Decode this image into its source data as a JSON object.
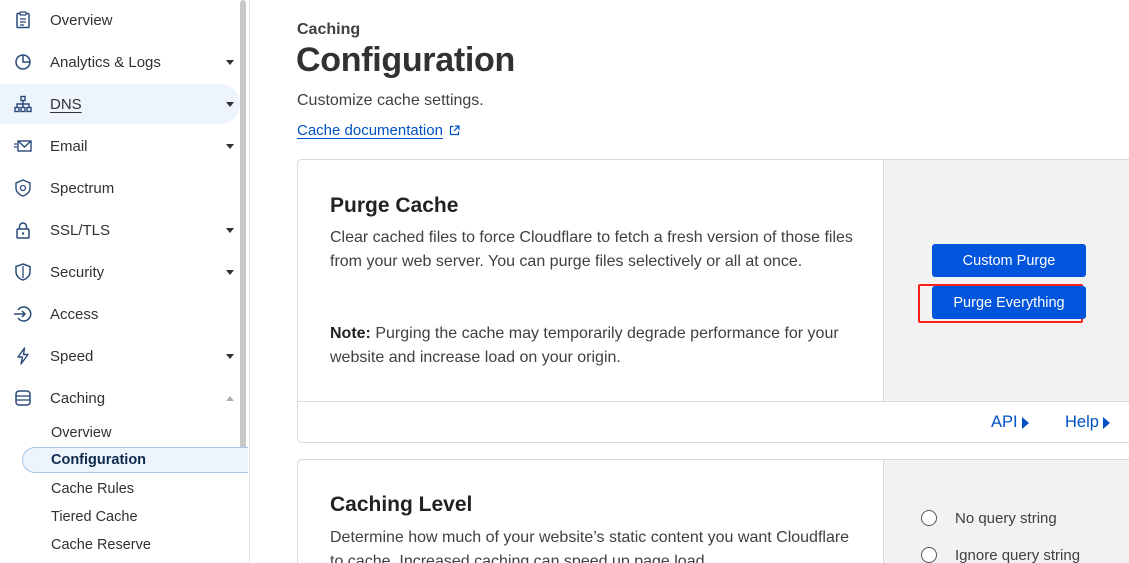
{
  "sidebar": {
    "items": [
      {
        "label": "Overview",
        "icon": "clipboard-icon",
        "caret": false
      },
      {
        "label": "Analytics & Logs",
        "icon": "chart-pie-icon",
        "caret": true
      },
      {
        "label": "DNS",
        "icon": "network-icon",
        "caret": true,
        "active": true
      },
      {
        "label": "Email",
        "icon": "envelope-icon",
        "caret": true
      },
      {
        "label": "Spectrum",
        "icon": "spectrum-shield-icon",
        "caret": false
      },
      {
        "label": "SSL/TLS",
        "icon": "lock-icon",
        "caret": true
      },
      {
        "label": "Security",
        "icon": "shield-icon",
        "caret": true
      },
      {
        "label": "Access",
        "icon": "access-arrow-icon",
        "caret": false
      },
      {
        "label": "Speed",
        "icon": "lightning-icon",
        "caret": true
      },
      {
        "label": "Caching",
        "icon": "database-icon",
        "caret": "up"
      }
    ],
    "subitems": [
      {
        "label": "Overview"
      },
      {
        "label": "Configuration",
        "active": true
      },
      {
        "label": "Cache Rules"
      },
      {
        "label": "Tiered Cache"
      },
      {
        "label": "Cache Reserve"
      }
    ]
  },
  "header": {
    "eyebrow": "Caching",
    "title": "Configuration",
    "subtitle": "Customize cache settings.",
    "doc_link": "Cache documentation"
  },
  "purge_card": {
    "title": "Purge Cache",
    "description": "Clear cached files to force Cloudflare to fetch a fresh version of those files from your web server. You can purge files selectively or all at once.",
    "note_label": "Note:",
    "note_text": " Purging the cache may temporarily degrade performance for your website and increase load on your origin.",
    "custom_purge_label": "Custom Purge",
    "purge_everything_label": "Purge Everything",
    "api_link": "API",
    "help_link": "Help"
  },
  "caching_level_card": {
    "title": "Caching Level",
    "description": "Determine how much of your website’s static content you want Cloudflare to cache. Increased caching can speed up page load",
    "options": [
      "No query string",
      "Ignore query string"
    ]
  },
  "colors": {
    "accent": "#0055dc",
    "link": "#0051c3",
    "highlight": "#ff1e1e"
  }
}
